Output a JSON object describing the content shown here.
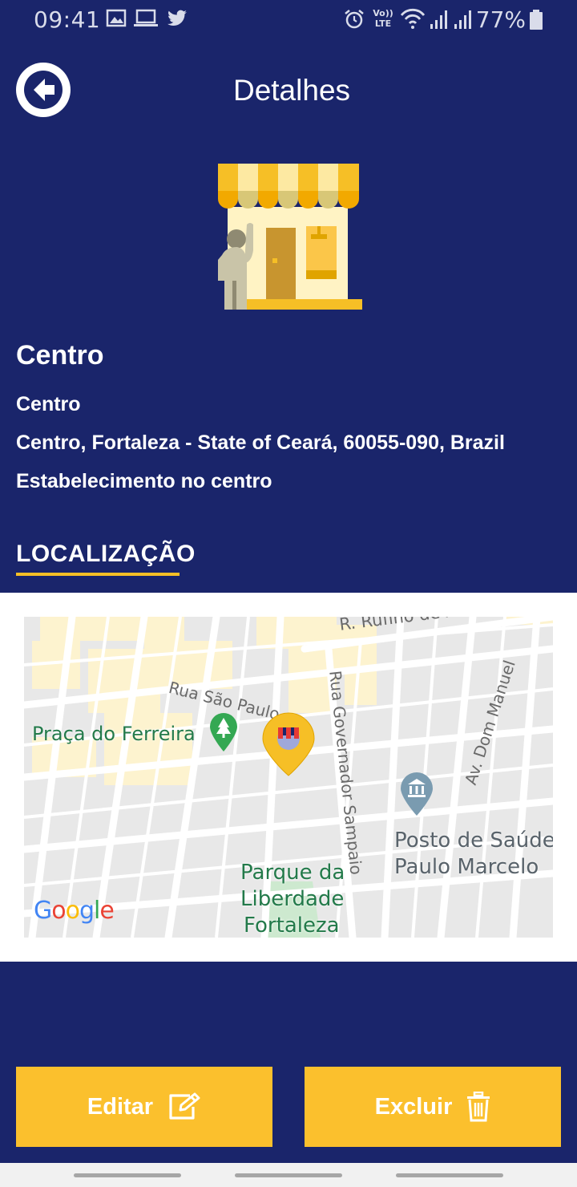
{
  "status_bar": {
    "time": "09:41",
    "battery": "77%",
    "icons": [
      "image-icon",
      "laptop-icon",
      "twitter-icon",
      "alarm-icon",
      "volte-icon",
      "wifi-icon",
      "signal-icon",
      "signal-icon",
      "battery-icon"
    ],
    "volte_top": "Vo))",
    "volte_bottom": "LTE"
  },
  "header": {
    "title": "Detalhes",
    "back_icon": "arrow-left-icon"
  },
  "place": {
    "name": "Centro",
    "line1": "Centro",
    "address": "Centro, Fortaleza - State of Ceará, 60055-090, Brazil",
    "description": "Estabelecimento no centro",
    "illustration": "store-icon"
  },
  "location": {
    "section_title": "LOCALIZAÇÃO",
    "accent_color": "#f6bf26",
    "map": {
      "labels": {
        "rufino": "R. Rufino de Alençar",
        "sao_paulo": "Rua São Paulo",
        "governador": "Rua Governador Sampaio",
        "dom_manuel": "Av. Dom Manuel",
        "praca": "Praça do Ferreira",
        "posto_1": "Posto de Saúde",
        "posto_2": "Paulo Marcelo",
        "parque_1": "Parque da",
        "parque_2": "Liberdade",
        "parque_3": "Fortaleza"
      },
      "logo": {
        "g1": "G",
        "o1": "o",
        "o2": "o",
        "g2": "g",
        "l": "l",
        "e": "e"
      }
    }
  },
  "actions": {
    "edit_label": "Editar",
    "edit_icon": "edit-icon",
    "delete_label": "Excluir",
    "delete_icon": "trash-icon"
  },
  "colors": {
    "background": "#1a256b",
    "button": "#fbc02d",
    "text": "#ffffff"
  }
}
